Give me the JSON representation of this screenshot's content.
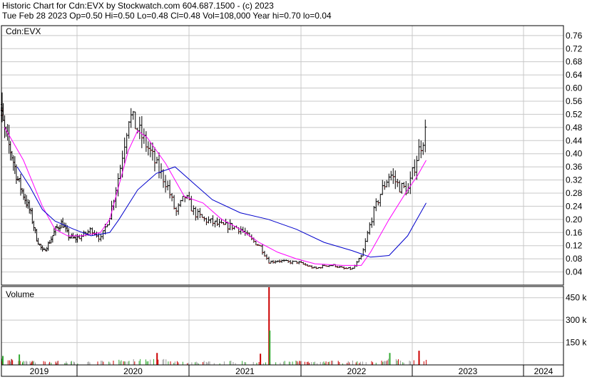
{
  "header": {
    "line1": "Historic Chart for Cdn:EVX by Stockwatch.com 604.687.1500 - (c) 2023",
    "line2": "Tue Feb 28 2023  Op=0.50  Hi=0.50  Lo=0.48  Cl=0.48  Vol=108,000  Year hi=0.70  lo=0.04"
  },
  "chart_data": [
    {
      "type": "ohlc",
      "title": "Cdn:EVX",
      "ylim": [
        0.0,
        0.79
      ],
      "y_ticks": [
        "0.76",
        "0.72",
        "0.68",
        "0.64",
        "0.60",
        "0.56",
        "0.52",
        "0.48",
        "0.44",
        "0.40",
        "0.36",
        "0.32",
        "0.28",
        "0.24",
        "0.20",
        "0.16",
        "0.12",
        "0.08",
        "0.04"
      ],
      "x_labels": [
        "2019",
        "2020",
        "2021",
        "2022",
        "2023",
        "2024"
      ],
      "grid": true,
      "colors": {
        "price": "#000000",
        "down_tick": "#cc0000",
        "ma_short": "#ff00ff",
        "ma_long": "#0000cc",
        "grid": "#c8c8c8"
      },
      "price_path": [
        [
          "2018-12",
          0.55
        ],
        [
          "2019-01",
          0.46
        ],
        [
          "2019-02",
          0.4
        ],
        [
          "2019-03",
          0.32
        ],
        [
          "2019-04",
          0.27
        ],
        [
          "2019-05",
          0.22
        ],
        [
          "2019-06",
          0.14
        ],
        [
          "2019-07",
          0.1
        ],
        [
          "2019-08",
          0.13
        ],
        [
          "2019-09",
          0.17
        ],
        [
          "2019-10",
          0.19
        ],
        [
          "2019-11",
          0.15
        ],
        [
          "2019-12",
          0.14
        ],
        [
          "2020-01",
          0.15
        ],
        [
          "2020-02",
          0.17
        ],
        [
          "2020-03",
          0.14
        ],
        [
          "2020-04",
          0.22
        ],
        [
          "2020-05",
          0.35
        ],
        [
          "2020-06",
          0.52
        ],
        [
          "2020-07",
          0.47
        ],
        [
          "2020-08",
          0.42
        ],
        [
          "2020-09",
          0.36
        ],
        [
          "2020-10",
          0.31
        ],
        [
          "2020-11",
          0.22
        ],
        [
          "2020-12",
          0.27
        ],
        [
          "2021-01",
          0.22
        ],
        [
          "2021-02",
          0.2
        ],
        [
          "2021-03",
          0.19
        ],
        [
          "2021-04",
          0.18
        ],
        [
          "2021-05",
          0.18
        ],
        [
          "2021-06",
          0.17
        ],
        [
          "2021-07",
          0.14
        ],
        [
          "2021-08",
          0.12
        ],
        [
          "2021-09",
          0.07
        ],
        [
          "2021-10",
          0.075
        ],
        [
          "2021-11",
          0.07
        ],
        [
          "2021-12",
          0.07
        ],
        [
          "2022-01",
          0.06
        ],
        [
          "2022-02",
          0.05
        ],
        [
          "2022-03",
          0.06
        ],
        [
          "2022-04",
          0.06
        ],
        [
          "2022-05",
          0.05
        ],
        [
          "2022-06",
          0.05
        ],
        [
          "2022-07",
          0.09
        ],
        [
          "2022-08",
          0.2
        ],
        [
          "2022-09",
          0.28
        ],
        [
          "2022-10",
          0.34
        ],
        [
          "2022-11",
          0.3
        ],
        [
          "2022-12",
          0.29
        ],
        [
          "2023-01",
          0.4
        ],
        [
          "2023-02",
          0.48
        ]
      ],
      "series": [
        {
          "values": [
            [
              "2019-01",
              0.48
            ],
            [
              "2019-04",
              0.38
            ],
            [
              "2019-07",
              0.24
            ],
            [
              "2019-09",
              0.17
            ],
            [
              "2019-11",
              0.15
            ],
            [
              "2020-01",
              0.15
            ],
            [
              "2020-03",
              0.16
            ],
            [
              "2020-04",
              0.2
            ],
            [
              "2020-06",
              0.41
            ],
            [
              "2020-07",
              0.47
            ],
            [
              "2020-08",
              0.45
            ],
            [
              "2020-10",
              0.37
            ],
            [
              "2020-11",
              0.32
            ],
            [
              "2020-12",
              0.27
            ],
            [
              "2021-02",
              0.25
            ],
            [
              "2021-04",
              0.2
            ],
            [
              "2021-06",
              0.17
            ],
            [
              "2021-08",
              0.13
            ],
            [
              "2021-10",
              0.1
            ],
            [
              "2021-12",
              0.08
            ],
            [
              "2022-02",
              0.065
            ],
            [
              "2022-05",
              0.06
            ],
            [
              "2022-07",
              0.06
            ],
            [
              "2022-08",
              0.1
            ],
            [
              "2022-10",
              0.2
            ],
            [
              "2022-12",
              0.29
            ],
            [
              "2023-01",
              0.33
            ],
            [
              "2023-02",
              0.38
            ]
          ]
        },
        {
          "values": [
            [
              "2019-03",
              0.36
            ],
            [
              "2019-05",
              0.3
            ],
            [
              "2019-07",
              0.23
            ],
            [
              "2019-09",
              0.195
            ],
            [
              "2019-12",
              0.17
            ],
            [
              "2020-02",
              0.15
            ],
            [
              "2020-04",
              0.16
            ],
            [
              "2020-05",
              0.2
            ],
            [
              "2020-07",
              0.29
            ],
            [
              "2020-09",
              0.34
            ],
            [
              "2020-11",
              0.36
            ],
            [
              "2021-01",
              0.31
            ],
            [
              "2021-03",
              0.26
            ],
            [
              "2021-06",
              0.22
            ],
            [
              "2021-09",
              0.2
            ],
            [
              "2021-12",
              0.17
            ],
            [
              "2022-03",
              0.13
            ],
            [
              "2022-06",
              0.105
            ],
            [
              "2022-08",
              0.085
            ],
            [
              "2022-10",
              0.09
            ],
            [
              "2022-12",
              0.15
            ],
            [
              "2023-01",
              0.2
            ],
            [
              "2023-02",
              0.25
            ]
          ]
        }
      ]
    },
    {
      "type": "bar",
      "title": "Volume",
      "ylim": [
        0,
        525000
      ],
      "y_ticks": [
        "450 k",
        "300 k",
        "150 k"
      ],
      "spikes": [
        [
          "2021-09",
          520000
        ],
        [
          "2021-09",
          230000
        ],
        [
          "2023-01",
          95000
        ],
        [
          "2022-10",
          80000
        ],
        [
          "2021-08",
          75000
        ],
        [
          "2019-03",
          70000
        ],
        [
          "2020-09",
          80000
        ],
        [
          "2018-12",
          60000
        ]
      ]
    }
  ]
}
